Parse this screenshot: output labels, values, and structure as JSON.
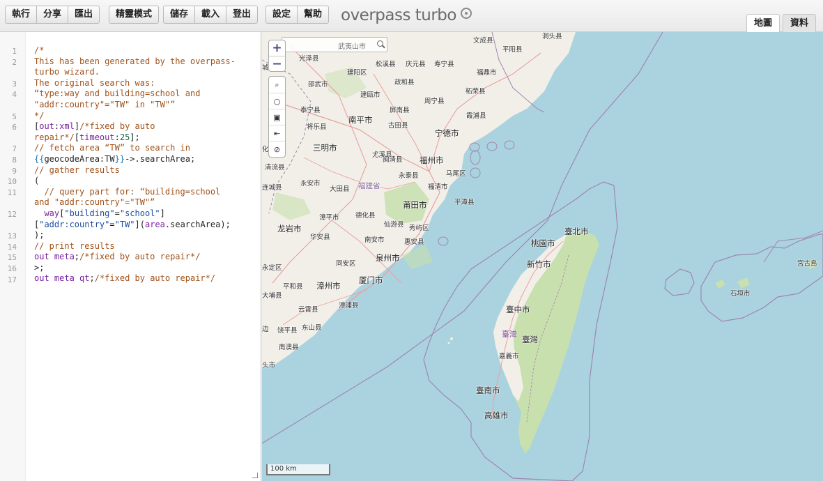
{
  "toolbar": {
    "groups": [
      [
        "執行",
        "分享",
        "匯出"
      ],
      [
        "精靈模式"
      ],
      [
        "儲存",
        "載入",
        "登出"
      ],
      [
        "設定",
        "幫助"
      ]
    ]
  },
  "app": {
    "title": "overpass turbo"
  },
  "tabs": [
    {
      "label": "地圖",
      "active": true
    },
    {
      "label": "資料",
      "active": false
    }
  ],
  "editor": {
    "line_numbers": [
      "1",
      "2",
      "3",
      "4",
      "5",
      "6",
      "7",
      "8",
      "9",
      "10",
      "11",
      "12",
      "13",
      "14",
      "15",
      "16",
      "17"
    ],
    "visual_lines": [
      {
        "n": "1",
        "tokens": [
          [
            "cm",
            "/*"
          ]
        ]
      },
      {
        "n": "2",
        "tokens": [
          [
            "cm",
            "This has been generated by the overpass-"
          ]
        ]
      },
      {
        "n": "",
        "tokens": [
          [
            "cm",
            "turbo wizard."
          ]
        ]
      },
      {
        "n": "3",
        "tokens": [
          [
            "cm",
            "The original search was:"
          ]
        ]
      },
      {
        "n": "4",
        "tokens": [
          [
            "cm",
            "“type:way and building=school and"
          ]
        ]
      },
      {
        "n": "",
        "tokens": [
          [
            "cm",
            "\"addr:country\"=\"TW\" in \"TW\"”"
          ]
        ]
      },
      {
        "n": "5",
        "tokens": [
          [
            "cm",
            "*/"
          ]
        ]
      },
      {
        "n": "6",
        "tokens": [
          [
            "pl",
            "["
          ],
          [
            "kw",
            "out"
          ],
          [
            "pl",
            ":"
          ],
          [
            "kw",
            "xml"
          ],
          [
            "pl",
            "]"
          ],
          [
            "cm",
            "/*fixed by auto"
          ]
        ]
      },
      {
        "n": "",
        "tokens": [
          [
            "cm",
            "repair*/"
          ],
          [
            "pl",
            "["
          ],
          [
            "kw",
            "timeout"
          ],
          [
            "pl",
            ":"
          ],
          [
            "num",
            "25"
          ],
          [
            "pl",
            "];"
          ]
        ]
      },
      {
        "n": "7",
        "tokens": [
          [
            "cm",
            "// fetch area “TW” to search in"
          ]
        ]
      },
      {
        "n": "8",
        "tokens": [
          [
            "tpl",
            "{{"
          ],
          [
            "pl",
            "geocodeArea:TW"
          ],
          [
            "tpl",
            "}}"
          ],
          [
            "pl",
            "->.searchArea;"
          ]
        ]
      },
      {
        "n": "9",
        "tokens": [
          [
            "cm",
            "// gather results"
          ]
        ]
      },
      {
        "n": "10",
        "tokens": [
          [
            "pl",
            "("
          ]
        ]
      },
      {
        "n": "11",
        "tokens": [
          [
            "cm",
            "  // query part for: “building=school"
          ]
        ]
      },
      {
        "n": "",
        "tokens": [
          [
            "cm",
            "and \"addr:country\"=\"TW\"”"
          ]
        ]
      },
      {
        "n": "12",
        "tokens": [
          [
            "pl",
            "  "
          ],
          [
            "kw",
            "way"
          ],
          [
            "pl",
            "["
          ],
          [
            "st",
            "\"building\""
          ],
          [
            "pl",
            "="
          ],
          [
            "st",
            "\"school\""
          ],
          [
            "pl",
            "]"
          ]
        ]
      },
      {
        "n": "",
        "tokens": [
          [
            "pl",
            "["
          ],
          [
            "st",
            "\"addr:country\""
          ],
          [
            "pl",
            "="
          ],
          [
            "st",
            "\"TW\""
          ],
          [
            "pl",
            "]("
          ],
          [
            "kw",
            "area"
          ],
          [
            "pl",
            ".searchArea);"
          ]
        ]
      },
      {
        "n": "13",
        "tokens": [
          [
            "pl",
            ");"
          ]
        ]
      },
      {
        "n": "14",
        "tokens": [
          [
            "cm",
            "// print results"
          ]
        ]
      },
      {
        "n": "15",
        "tokens": [
          [
            "kw",
            "out meta"
          ],
          [
            "pl",
            ";"
          ],
          [
            "cm",
            "/*fixed by auto repair*/"
          ]
        ]
      },
      {
        "n": "16",
        "tokens": [
          [
            "pl",
            ">;"
          ]
        ]
      },
      {
        "n": "17",
        "tokens": [
          [
            "kw",
            "out meta qt"
          ],
          [
            "pl",
            ";"
          ],
          [
            "cm",
            "/*fixed by auto repair*/"
          ]
        ]
      }
    ]
  },
  "map": {
    "search_placeholder": "武夷山市",
    "zoom_in": "+",
    "zoom_out": "−",
    "scale": "100 km",
    "colors": {
      "sea": "#aad3df",
      "land": "#f2efe9",
      "forest": "#c8dfae",
      "border": "#9e87b0",
      "road": "#e8a0a0"
    },
    "places": [
      {
        "name": "洞头县"
      },
      {
        "name": "文成县"
      },
      {
        "name": "平阳县"
      },
      {
        "name": "光泽县"
      },
      {
        "name": "松溪县"
      },
      {
        "name": "庆元县"
      },
      {
        "name": "寿宁县"
      },
      {
        "name": "建阳区"
      },
      {
        "name": "政和县"
      },
      {
        "name": "福鼎市"
      },
      {
        "name": "邵武市"
      },
      {
        "name": "柘荣县"
      },
      {
        "name": "建瓯市"
      },
      {
        "name": "周宁县"
      },
      {
        "name": "泰宁县"
      },
      {
        "name": "屏南县"
      },
      {
        "name": "南平市"
      },
      {
        "name": "古田县"
      },
      {
        "name": "霞浦县"
      },
      {
        "name": "将乐县"
      },
      {
        "name": "宁德市"
      },
      {
        "name": "三明市"
      },
      {
        "name": "尤溪县"
      },
      {
        "name": "闽清县"
      },
      {
        "name": "福州市"
      },
      {
        "name": "清流县"
      },
      {
        "name": "马尾区"
      },
      {
        "name": "永泰县"
      },
      {
        "name": "永安市"
      },
      {
        "name": "大田县"
      },
      {
        "name": "福建省"
      },
      {
        "name": "福清市"
      },
      {
        "name": "连城县"
      },
      {
        "name": "平潭县"
      },
      {
        "name": "莆田市"
      },
      {
        "name": "漳平市"
      },
      {
        "name": "德化县"
      },
      {
        "name": "仙游县"
      },
      {
        "name": "秀屿区"
      },
      {
        "name": "龙岩市"
      },
      {
        "name": "华安县"
      },
      {
        "name": "南安市"
      },
      {
        "name": "惠安县"
      },
      {
        "name": "永定区"
      },
      {
        "name": "泉州市"
      },
      {
        "name": "同安区"
      },
      {
        "name": "平和县"
      },
      {
        "name": "漳州市"
      },
      {
        "name": "厦门市"
      },
      {
        "name": "大埔县"
      },
      {
        "name": "云霄县"
      },
      {
        "name": "漳浦县"
      },
      {
        "name": "饶平县"
      },
      {
        "name": "东山县"
      },
      {
        "name": "南澳县"
      },
      {
        "name": "头市"
      },
      {
        "name": "臺北市"
      },
      {
        "name": "桃園市"
      },
      {
        "name": "新竹市"
      },
      {
        "name": "臺中市"
      },
      {
        "name": "臺灣"
      },
      {
        "name": "臺灣"
      },
      {
        "name": "嘉義市"
      },
      {
        "name": "臺南市"
      },
      {
        "name": "高雄市"
      },
      {
        "name": "石垣市"
      },
      {
        "name": "宮古島"
      },
      {
        "name": "城"
      },
      {
        "name": "化"
      },
      {
        "name": "边"
      }
    ]
  }
}
